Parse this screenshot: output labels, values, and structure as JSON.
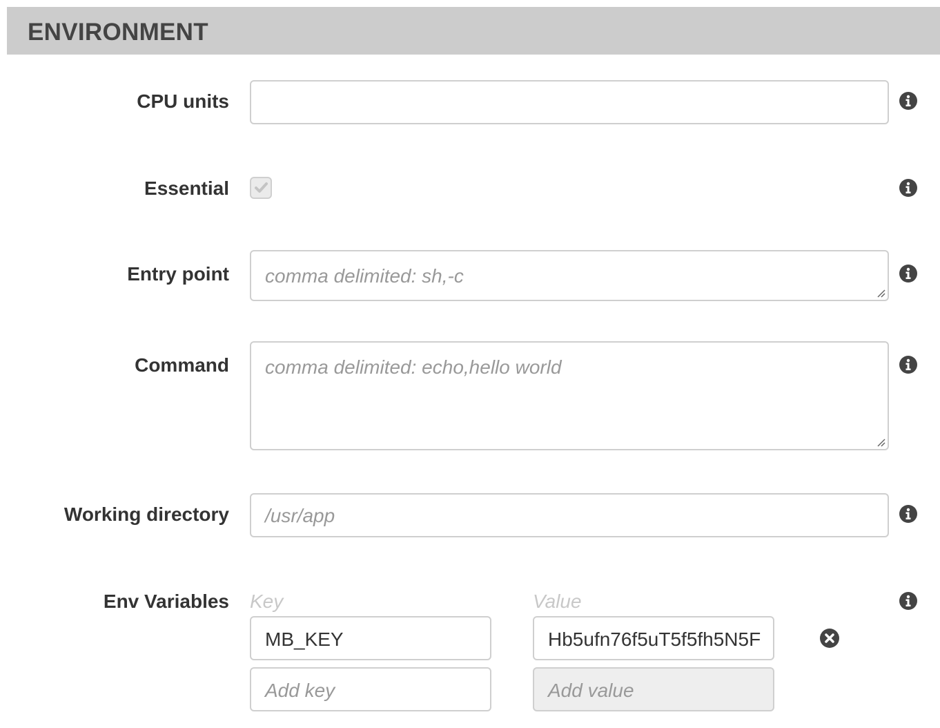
{
  "section": {
    "title": "ENVIRONMENT"
  },
  "fields": {
    "cpu_units": {
      "label": "CPU units",
      "value": "",
      "placeholder": ""
    },
    "essential": {
      "label": "Essential",
      "checked": true,
      "disabled": true
    },
    "entry_point": {
      "label": "Entry point",
      "placeholder": "comma delimited: sh,-c"
    },
    "command": {
      "label": "Command",
      "placeholder": "comma delimited: echo,hello world"
    },
    "working_directory": {
      "label": "Working directory",
      "placeholder": "/usr/app"
    },
    "env_variables": {
      "label": "Env Variables",
      "key_header": "Key",
      "value_header": "Value",
      "rows": [
        {
          "key": "MB_KEY",
          "value": "Hb5ufn76f5uT5f5fh5N5F"
        }
      ],
      "new_key_placeholder": "Add key",
      "new_value_placeholder": "Add value"
    }
  },
  "icons": {
    "info": "info-circle-icon",
    "remove": "remove-circle-icon"
  },
  "colors": {
    "header_bg": "#cccccc",
    "label_text": "#333333",
    "placeholder_text": "#999999",
    "border": "#cfcfcf",
    "icon": "#444444"
  }
}
